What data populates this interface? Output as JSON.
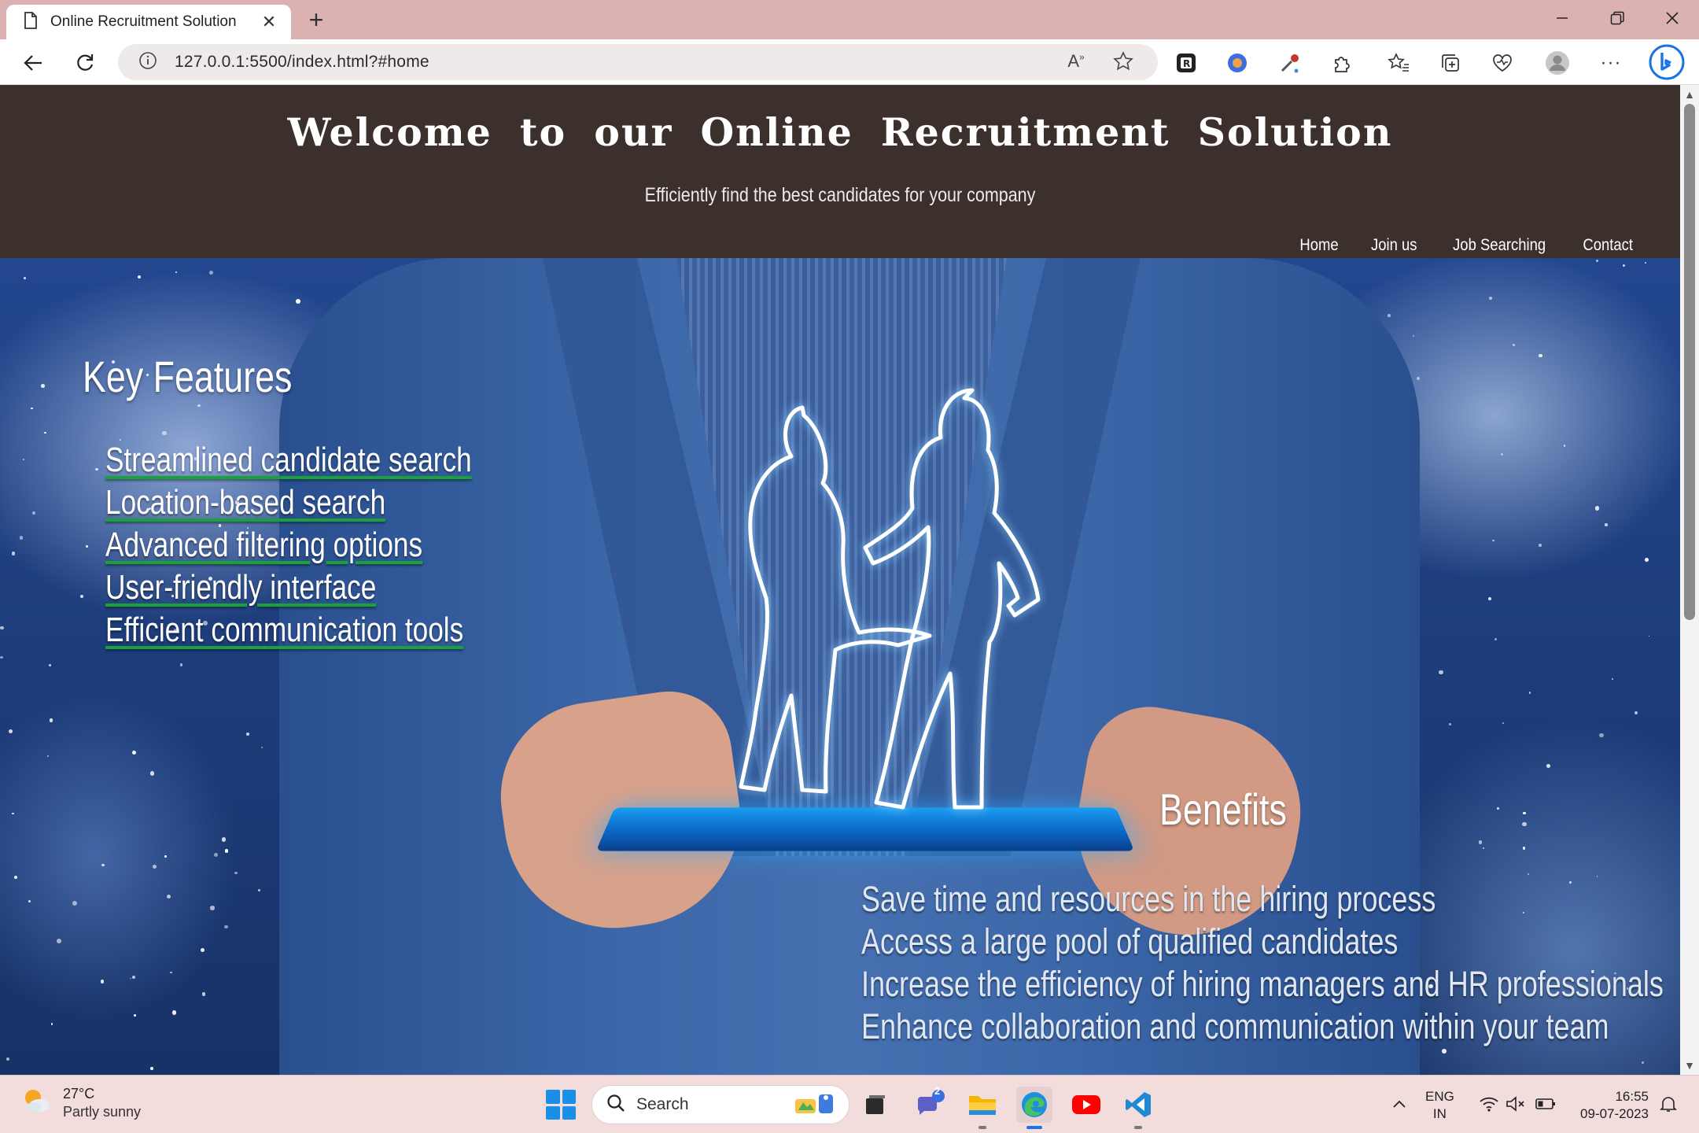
{
  "browser": {
    "tab_title": "Online Recruitment Solution",
    "url": "127.0.0.1:5500/index.html?#home"
  },
  "header": {
    "title": "Welcome to our Online Recruitment Solution",
    "subtitle": "Efficiently find the best candidates for your company",
    "nav": [
      "Home",
      "Join us",
      "Job Searching",
      "Contact"
    ]
  },
  "key_features": {
    "title": "Key Features",
    "items": [
      "Streamlined candidate search",
      "Location-based search",
      "Advanced filtering options",
      "User-friendly interface",
      "Efficient communication tools"
    ]
  },
  "benefits": {
    "title": "Benefits",
    "items": [
      "Save time and resources in the hiring process",
      "Access a large pool of qualified candidates",
      "Increase the efficiency of hiring managers and HR professionals",
      "Enhance collaboration and communication within your team"
    ]
  },
  "taskbar": {
    "weather_temp": "27°C",
    "weather_desc": "Partly sunny",
    "search_label": "Search",
    "teams_badge": "2",
    "lang_line1": "ENG",
    "lang_line2": "IN",
    "time": "16:55",
    "date": "09-07-2023"
  },
  "icons": {
    "tab": "page-icon",
    "nav": [
      "back-icon",
      "refresh-icon",
      "info-icon"
    ],
    "toolbar": [
      "read-aloud-icon",
      "favorite-star-icon",
      "extension-icons",
      "extensions-puzzle-icon",
      "favorites-icon",
      "collections-icon",
      "browser-essentials-icon",
      "profile-icon",
      "more-icon",
      "bing-icon"
    ],
    "window": [
      "minimize-icon",
      "restore-icon",
      "close-icon"
    ]
  },
  "colors": {
    "header_bg": "#3c302d",
    "tabstrip_bg": "#dbb1b1",
    "feature_underline": "#17a33a",
    "taskbar_bg": "#f2dcdc"
  }
}
